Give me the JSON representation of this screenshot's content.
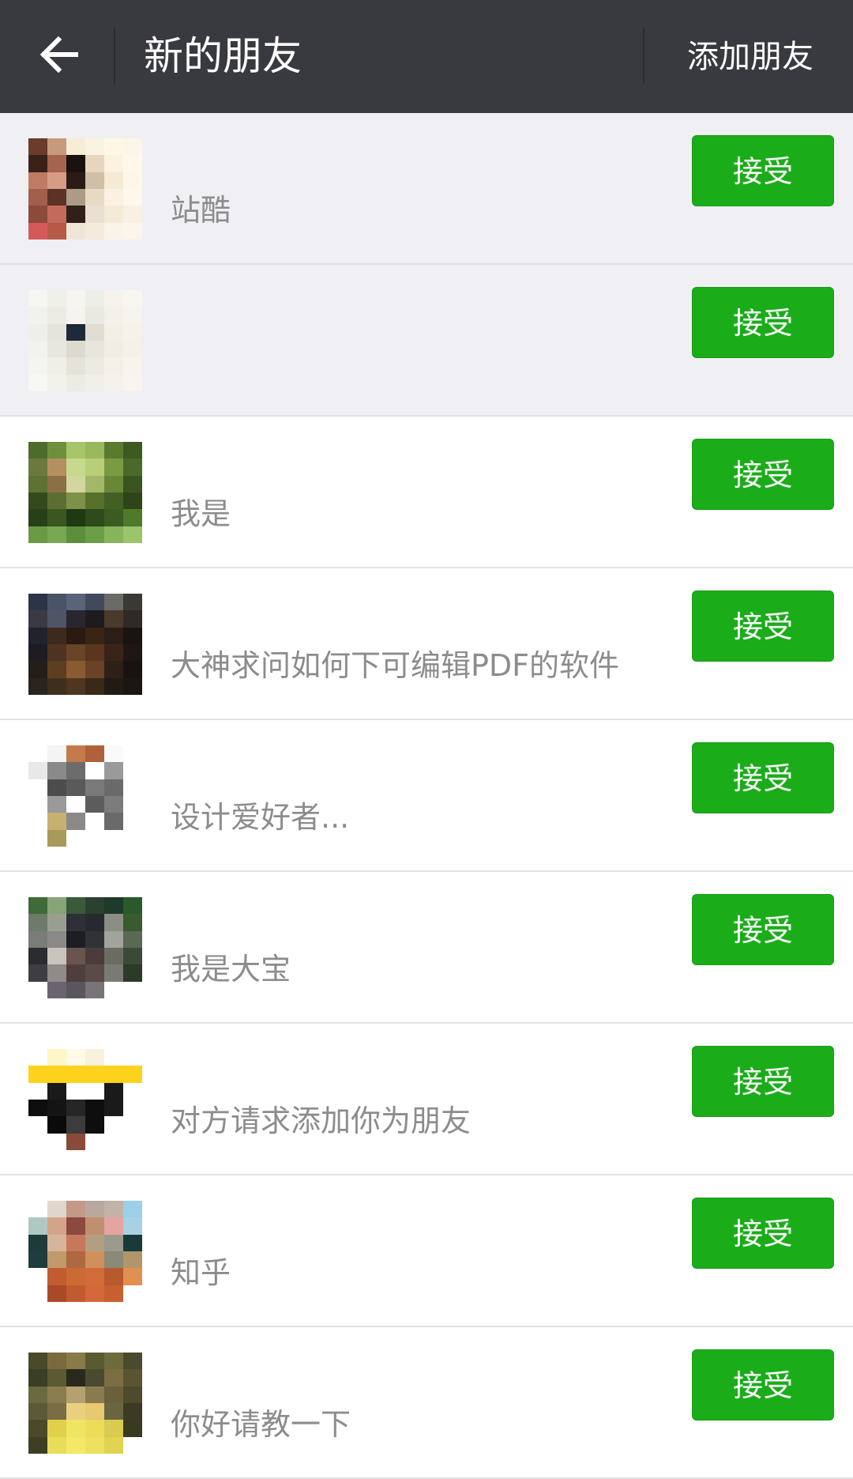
{
  "header": {
    "title": "新的朋友",
    "add_friend_label": "添加朋友",
    "back_icon": "arrow-left-icon",
    "background": "#393a3f"
  },
  "requests": [
    {
      "name": "",
      "message": "站酷",
      "accept_label": "接受",
      "unread": true
    },
    {
      "name": "",
      "message": "",
      "accept_label": "接受",
      "unread": true
    },
    {
      "name": "",
      "message": "我是",
      "accept_label": "接受",
      "unread": false
    },
    {
      "name": "",
      "message": "大神求问如何下可编辑PDF的软件",
      "accept_label": "接受",
      "unread": false
    },
    {
      "name": "",
      "message": "设计爱好者...",
      "accept_label": "接受",
      "unread": false
    },
    {
      "name": "",
      "message": "我是大宝",
      "accept_label": "接受",
      "unread": false
    },
    {
      "name": "",
      "message": "对方请求添加你为朋友",
      "accept_label": "接受",
      "unread": false
    },
    {
      "name": "",
      "message": "知乎",
      "accept_label": "接受",
      "unread": false
    },
    {
      "name": "",
      "message": "你好请教一下",
      "accept_label": "接受",
      "unread": false
    }
  ],
  "colors": {
    "accent_green": "#1aad19",
    "unread_row": "#efeff4",
    "message_gray": "#8c8c8c"
  }
}
